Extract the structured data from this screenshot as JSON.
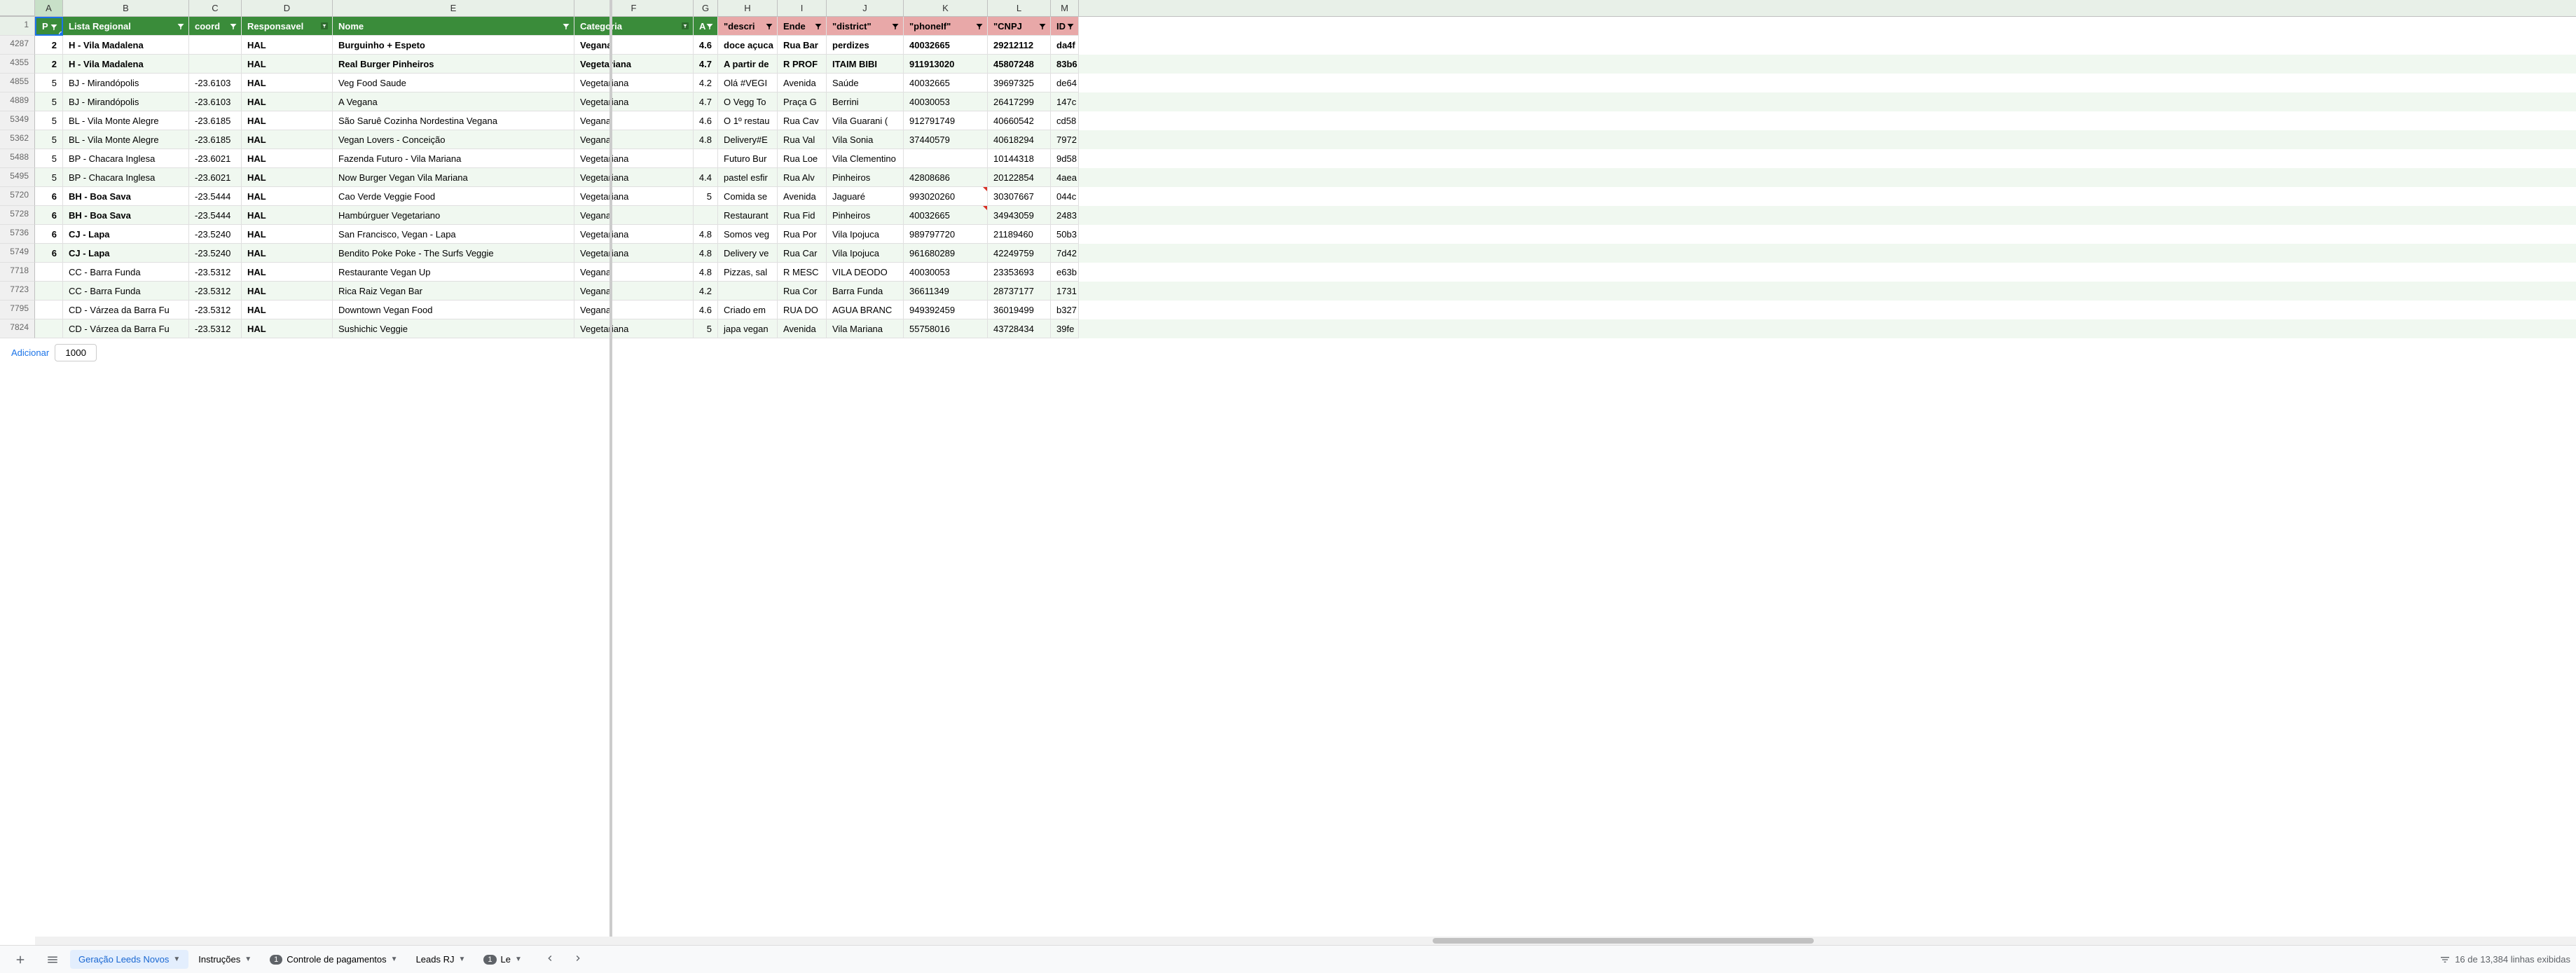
{
  "columns": [
    "A",
    "B",
    "C",
    "D",
    "E",
    "F",
    "G",
    "H",
    "I",
    "J",
    "K",
    "L",
    "M"
  ],
  "header_row_num": "1",
  "headers": {
    "A": "P",
    "B": "Lista Regional",
    "C": "coord",
    "D": "Responsavel",
    "E": "Nome",
    "F": "Categoria",
    "G": "A",
    "H": "\"descri",
    "I": "Ende",
    "J": "\"district\"",
    "K": "\"phoneIf\"",
    "L": "\"CNPJ",
    "M": "ID"
  },
  "header_styles": {
    "H": "pink",
    "I": "pink",
    "J": "pink",
    "K": "pink",
    "L": "pink",
    "M": "pink"
  },
  "filter_active": {
    "D": true,
    "F": true
  },
  "rows": [
    {
      "num": "4287",
      "bold": true,
      "even": false,
      "cells": {
        "A": "2",
        "B": "H - Vila Madalena",
        "C": "",
        "D": "HAL",
        "E": "Burguinho + Espeto",
        "F": "Vegana",
        "G": "4.6",
        "H": "doce açuca",
        "I": "Rua Bar",
        "J": "perdizes",
        "K": "40032665",
        "L": "29212112",
        "M": "da4f"
      }
    },
    {
      "num": "4355",
      "bold": true,
      "even": true,
      "cells": {
        "A": "2",
        "B": "H - Vila Madalena",
        "C": "",
        "D": "HAL",
        "E": "Real Burger Pinheiros",
        "F": "Vegetariana",
        "G": "4.7",
        "H": "A partir de",
        "I": "R PROF",
        "J": "ITAIM BIBI",
        "K": "911913020",
        "L": "45807248",
        "M": "83b6"
      }
    },
    {
      "num": "4855",
      "bold": false,
      "even": false,
      "cells": {
        "A": "5",
        "B": "BJ - Mirandópolis",
        "C": "-23.6103",
        "D": "HAL",
        "E": "Veg Food Saude",
        "F": "Vegetariana",
        "G": "4.2",
        "H": "Olá #VEGI",
        "I": "Avenida",
        "J": "Saúde",
        "K": "40032665",
        "L": "39697325",
        "M": "de64"
      }
    },
    {
      "num": "4889",
      "bold": false,
      "even": true,
      "cells": {
        "A": "5",
        "B": "BJ - Mirandópolis",
        "C": "-23.6103",
        "D": "HAL",
        "E": "A Vegana",
        "F": "Vegetariana",
        "G": "4.7",
        "H": "O Vegg To",
        "I": "Praça G",
        "J": "Berrini",
        "K": "40030053",
        "L": "26417299",
        "M": "147c"
      }
    },
    {
      "num": "5349",
      "bold": false,
      "even": false,
      "cells": {
        "A": "5",
        "B": "BL - Vila Monte Alegre",
        "C": "-23.6185",
        "D": "HAL",
        "E": "São Saruê Cozinha Nordestina Vegana",
        "F": "Vegana",
        "G": "4.6",
        "H": "O 1º restau",
        "I": "Rua Cav",
        "J": "Vila Guarani (",
        "K": "912791749",
        "L": "40660542",
        "M": "cd58"
      }
    },
    {
      "num": "5362",
      "bold": false,
      "even": true,
      "cells": {
        "A": "5",
        "B": "BL - Vila Monte Alegre",
        "C": "-23.6185",
        "D": "HAL",
        "E": "Vegan Lovers - Conceição",
        "F": "Vegana",
        "G": "4.8",
        "H": "Delivery#E",
        "I": "Rua Val",
        "J": "Vila Sonia",
        "K": "37440579",
        "L": "40618294",
        "M": "7972"
      }
    },
    {
      "num": "5488",
      "bold": false,
      "even": false,
      "cells": {
        "A": "5",
        "B": "BP - Chacara Inglesa",
        "C": "-23.6021",
        "D": "HAL",
        "E": "Fazenda Futuro - Vila Mariana",
        "F": "Vegetariana",
        "G": "",
        "H": "Futuro Bur",
        "I": "Rua Loe",
        "J": "Vila Clementino",
        "K": "",
        "L": "10144318",
        "M": "9d58"
      }
    },
    {
      "num": "5495",
      "bold": false,
      "even": true,
      "cells": {
        "A": "5",
        "B": "BP - Chacara Inglesa",
        "C": "-23.6021",
        "D": "HAL",
        "E": "Now Burger Vegan Vila Mariana",
        "F": "Vegetariana",
        "G": "4.4",
        "H": "pastel esfir",
        "I": "Rua Alv",
        "J": "Pinheiros",
        "K": "42808686",
        "L": "20122854",
        "M": "4aea"
      }
    },
    {
      "num": "5720",
      "bold": false,
      "even": false,
      "cells": {
        "A": "6",
        "B": "BH - Boa Sava",
        "C": "-23.5444",
        "D": "HAL",
        "E": "Cao Verde Veggie Food",
        "F": "Vegetariana",
        "G": "5",
        "H": "Comida se",
        "I": "Avenida",
        "J": "Jaguaré",
        "K": "993020260",
        "L": "30307667",
        "M": "044c"
      },
      "notes": [
        "K"
      ],
      "boldCols": [
        "A",
        "B"
      ]
    },
    {
      "num": "5728",
      "bold": false,
      "even": true,
      "cells": {
        "A": "6",
        "B": "BH - Boa Sava",
        "C": "-23.5444",
        "D": "HAL",
        "E": "Hambúrguer Vegetariano",
        "F": "Vegana",
        "G": "",
        "H": "Restaurant",
        "I": "Rua Fid",
        "J": "Pinheiros",
        "K": "40032665",
        "L": "34943059",
        "M": "2483"
      },
      "notes": [
        "K"
      ],
      "boldCols": [
        "A",
        "B"
      ]
    },
    {
      "num": "5736",
      "bold": false,
      "even": false,
      "cells": {
        "A": "6",
        "B": "CJ - Lapa",
        "C": "-23.5240",
        "D": "HAL",
        "E": "San Francisco, Vegan - Lapa",
        "F": "Vegetariana",
        "G": "4.8",
        "H": "Somos veg",
        "I": "Rua Por",
        "J": "Vila Ipojuca",
        "K": "989797720",
        "L": "21189460",
        "M": "50b3"
      },
      "boldCols": [
        "A",
        "B"
      ]
    },
    {
      "num": "5749",
      "bold": false,
      "even": true,
      "cells": {
        "A": "6",
        "B": "CJ - Lapa",
        "C": "-23.5240",
        "D": "HAL",
        "E": "Bendito Poke Poke - The Surfs Veggie",
        "F": "Vegetariana",
        "G": "4.8",
        "H": "Delivery ve",
        "I": "Rua Car",
        "J": "Vila Ipojuca",
        "K": "961680289",
        "L": "42249759",
        "M": "7d42"
      },
      "boldCols": [
        "A",
        "B"
      ]
    },
    {
      "num": "7718",
      "bold": false,
      "even": false,
      "cells": {
        "A": "",
        "B": "CC - Barra Funda",
        "C": "-23.5312",
        "D": "HAL",
        "E": "Restaurante Vegan Up",
        "F": "Vegana",
        "G": "4.8",
        "H": "Pizzas, sal",
        "I": "R MESC",
        "J": "VILA DEODO",
        "K": "40030053",
        "L": "23353693",
        "M": "e63b"
      }
    },
    {
      "num": "7723",
      "bold": false,
      "even": true,
      "cells": {
        "A": "",
        "B": "CC - Barra Funda",
        "C": "-23.5312",
        "D": "HAL",
        "E": "Rica Raiz Vegan Bar",
        "F": "Vegana",
        "G": "4.2",
        "H": "",
        "I": "Rua Cor",
        "J": "Barra Funda",
        "K": "36611349",
        "L": "28737177",
        "M": "1731"
      }
    },
    {
      "num": "7795",
      "bold": false,
      "even": false,
      "cells": {
        "A": "",
        "B": "CD - Várzea da Barra Fu",
        "C": "-23.5312",
        "D": "HAL",
        "E": "Downtown Vegan Food",
        "F": "Vegana",
        "G": "4.6",
        "H": "Criado em",
        "I": "RUA DO",
        "J": "AGUA BRANC",
        "K": "949392459",
        "L": "36019499",
        "M": "b327"
      }
    },
    {
      "num": "7824",
      "bold": false,
      "even": true,
      "cells": {
        "A": "",
        "B": "CD - Várzea da Barra Fu",
        "C": "-23.5312",
        "D": "HAL",
        "E": "Sushichic Veggie",
        "F": "Vegetariana",
        "G": "5",
        "H": "japa vegan",
        "I": "Avenida",
        "J": "Vila Mariana",
        "K": "55758016",
        "L": "43728434",
        "M": "39fe"
      }
    }
  ],
  "add_rows": {
    "label": "Adicionar",
    "value": "1000",
    "suffix": ""
  },
  "tabs": [
    {
      "label": "Geração Leeds Novos",
      "active": true,
      "badge": null
    },
    {
      "label": "Instruções",
      "active": false,
      "badge": null
    },
    {
      "label": "Controle de pagamentos",
      "active": false,
      "badge": "1"
    },
    {
      "label": "Leads RJ",
      "active": false,
      "badge": null
    },
    {
      "label": "Le",
      "active": false,
      "badge": "1"
    }
  ],
  "filter_status": "16 de 13,384 linhas exibidas"
}
